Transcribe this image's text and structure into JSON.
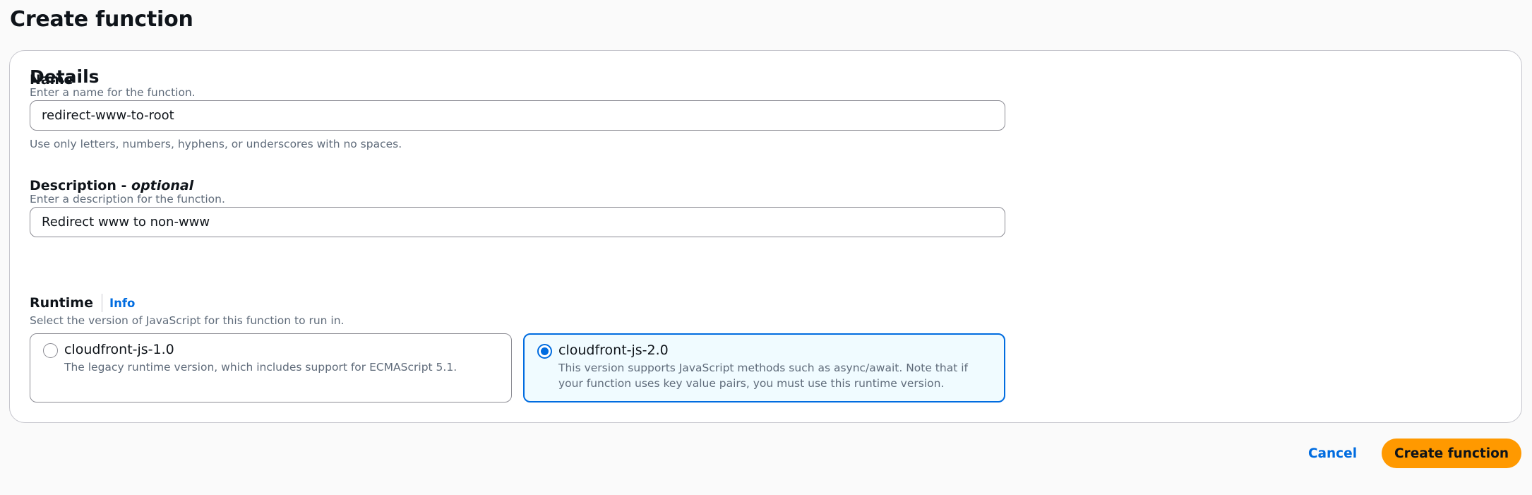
{
  "page": {
    "title": "Create function"
  },
  "details": {
    "title": "Details",
    "name": {
      "label": "Name",
      "description": "Enter a name for the function.",
      "value": "redirect-www-to-root",
      "constraint": "Use only letters, numbers, hyphens, or underscores with no spaces."
    },
    "description_field": {
      "label": "Description - ",
      "label_optional": "optional",
      "description": "Enter a description for the function.",
      "value": "Redirect www to non-www"
    },
    "runtime": {
      "label": "Runtime",
      "info_link": "Info",
      "description": "Select the version of JavaScript for this function to run in.",
      "selected": "cloudfront-js-2.0",
      "options": [
        {
          "label": "cloudfront-js-1.0",
          "description": "The legacy runtime version, which includes support for ECMAScript 5.1."
        },
        {
          "label": "cloudfront-js-2.0",
          "description": "This version supports JavaScript methods such as async/await. Note that if your function uses key value pairs, you must use this runtime version."
        }
      ]
    }
  },
  "actions": {
    "cancel_label": "Cancel",
    "create_label": "Create function"
  },
  "colors": {
    "accent": "#006ce0",
    "primary_button": "#ff9900",
    "selected_tile_bg": "#f0fbff"
  }
}
